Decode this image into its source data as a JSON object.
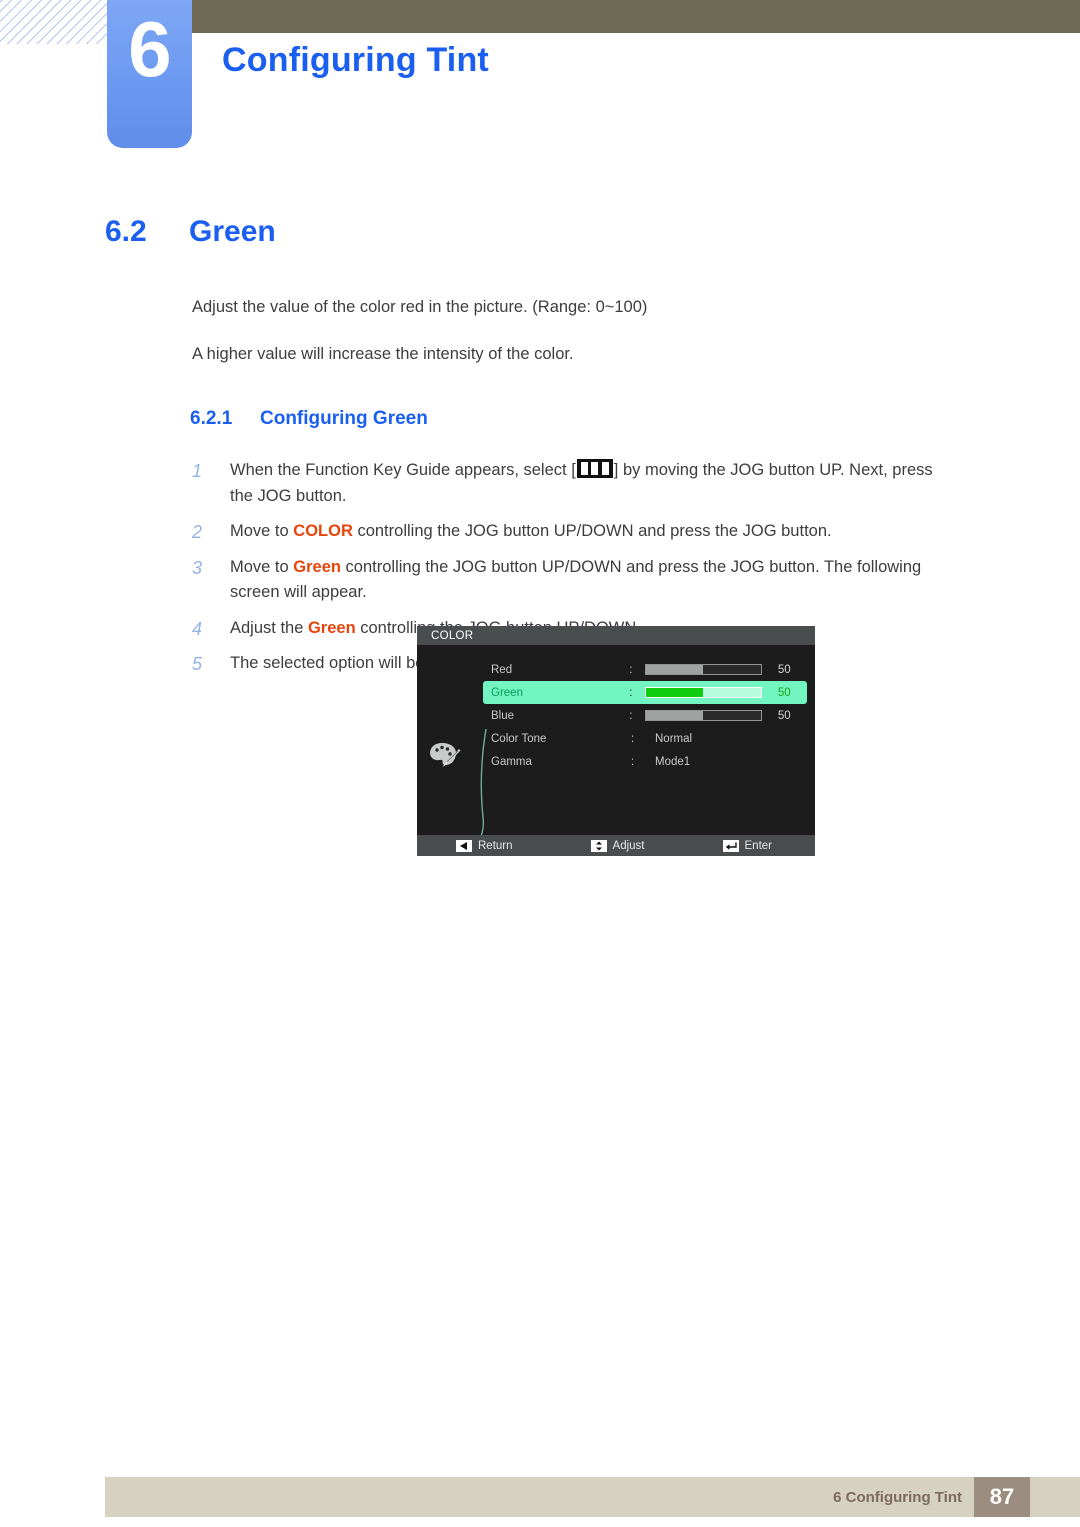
{
  "header": {
    "chapter_number": "6",
    "chapter_title": "Configuring Tint",
    "accent_blue": "#1a5ff0",
    "tab_blue": "#6f9cf2",
    "olive": "#6e6a54"
  },
  "section": {
    "number": "6.2",
    "title": "Green"
  },
  "paragraphs": {
    "p1": "Adjust the value of the color red in the picture. (Range: 0~100)",
    "p2": "A higher value will increase the intensity of the color."
  },
  "subsection": {
    "number": "6.2.1",
    "title": "Configuring Green"
  },
  "steps": [
    {
      "num": "1",
      "parts": [
        {
          "t": "When the Function Key Guide appears, select [",
          "style": "plain"
        },
        {
          "t": "",
          "style": "fkey-icon"
        },
        {
          "t": "] by moving the JOG button UP. Next, press the JOG button.",
          "style": "plain"
        }
      ]
    },
    {
      "num": "2",
      "parts": [
        {
          "t": "Move to ",
          "style": "plain"
        },
        {
          "t": "COLOR",
          "style": "orange"
        },
        {
          "t": " controlling the JOG button UP/DOWN and press the JOG button.",
          "style": "plain"
        }
      ]
    },
    {
      "num": "3",
      "parts": [
        {
          "t": "Move to ",
          "style": "plain"
        },
        {
          "t": "Green",
          "style": "orange"
        },
        {
          "t": " controlling the JOG button UP/DOWN and press the JOG button. The following screen will appear.",
          "style": "plain"
        }
      ]
    },
    {
      "num": "4",
      "parts": [
        {
          "t": "Adjust the ",
          "style": "plain"
        },
        {
          "t": "Green",
          "style": "orange"
        },
        {
          "t": " controlling the JOG button UP/DOWN.",
          "style": "plain"
        }
      ]
    },
    {
      "num": "5",
      "parts": [
        {
          "t": "The selected option will be applied.",
          "style": "plain"
        }
      ]
    }
  ],
  "osd": {
    "title": "COLOR",
    "rows": [
      {
        "label": "Red",
        "kind": "slider",
        "value": "50",
        "fill_pct": 50,
        "selected": false
      },
      {
        "label": "Green",
        "kind": "slider",
        "value": "50",
        "fill_pct": 50,
        "selected": true
      },
      {
        "label": "Blue",
        "kind": "slider",
        "value": "50",
        "fill_pct": 50,
        "selected": false
      },
      {
        "label": "Color Tone",
        "kind": "option",
        "value": "Normal",
        "selected": false
      },
      {
        "label": "Gamma",
        "kind": "option",
        "value": "Mode1",
        "selected": false
      }
    ],
    "buttons": [
      {
        "label": "Return",
        "icon": "left-triangle-icon"
      },
      {
        "label": "Adjust",
        "icon": "up-down-arrow-icon"
      },
      {
        "label": "Enter",
        "icon": "enter-key-icon"
      }
    ],
    "category_icon": "palette-icon",
    "highlight_color": "#72f5c0",
    "slider_fill_color": "#12cc12"
  },
  "footer": {
    "text": "6 Configuring Tint",
    "page": "87"
  }
}
